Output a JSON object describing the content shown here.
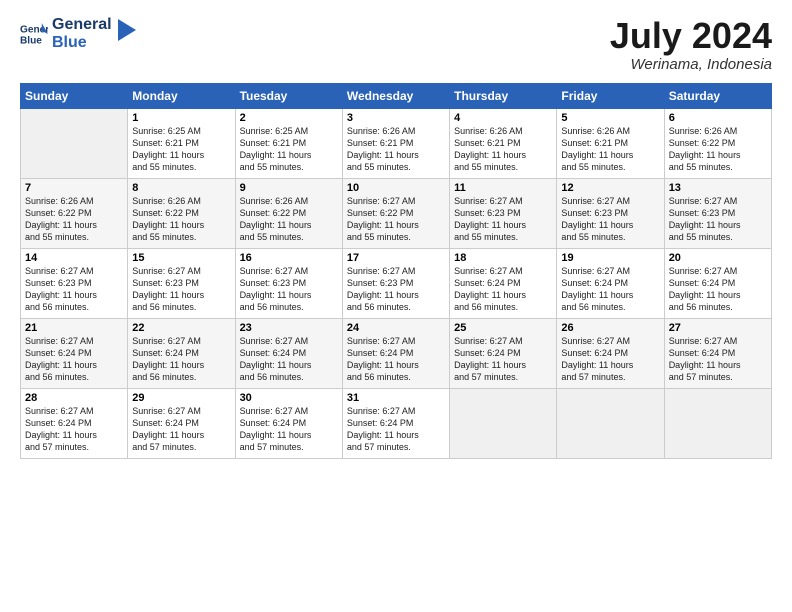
{
  "logo": {
    "line1": "General",
    "line2": "Blue"
  },
  "title": {
    "month_year": "July 2024",
    "location": "Werinama, Indonesia"
  },
  "header_days": [
    "Sunday",
    "Monday",
    "Tuesday",
    "Wednesday",
    "Thursday",
    "Friday",
    "Saturday"
  ],
  "weeks": [
    [
      {
        "num": "",
        "info": ""
      },
      {
        "num": "1",
        "info": "Sunrise: 6:25 AM\nSunset: 6:21 PM\nDaylight: 11 hours\nand 55 minutes."
      },
      {
        "num": "2",
        "info": "Sunrise: 6:25 AM\nSunset: 6:21 PM\nDaylight: 11 hours\nand 55 minutes."
      },
      {
        "num": "3",
        "info": "Sunrise: 6:26 AM\nSunset: 6:21 PM\nDaylight: 11 hours\nand 55 minutes."
      },
      {
        "num": "4",
        "info": "Sunrise: 6:26 AM\nSunset: 6:21 PM\nDaylight: 11 hours\nand 55 minutes."
      },
      {
        "num": "5",
        "info": "Sunrise: 6:26 AM\nSunset: 6:21 PM\nDaylight: 11 hours\nand 55 minutes."
      },
      {
        "num": "6",
        "info": "Sunrise: 6:26 AM\nSunset: 6:22 PM\nDaylight: 11 hours\nand 55 minutes."
      }
    ],
    [
      {
        "num": "7",
        "info": "Sunrise: 6:26 AM\nSunset: 6:22 PM\nDaylight: 11 hours\nand 55 minutes."
      },
      {
        "num": "8",
        "info": "Sunrise: 6:26 AM\nSunset: 6:22 PM\nDaylight: 11 hours\nand 55 minutes."
      },
      {
        "num": "9",
        "info": "Sunrise: 6:26 AM\nSunset: 6:22 PM\nDaylight: 11 hours\nand 55 minutes."
      },
      {
        "num": "10",
        "info": "Sunrise: 6:27 AM\nSunset: 6:22 PM\nDaylight: 11 hours\nand 55 minutes."
      },
      {
        "num": "11",
        "info": "Sunrise: 6:27 AM\nSunset: 6:23 PM\nDaylight: 11 hours\nand 55 minutes."
      },
      {
        "num": "12",
        "info": "Sunrise: 6:27 AM\nSunset: 6:23 PM\nDaylight: 11 hours\nand 55 minutes."
      },
      {
        "num": "13",
        "info": "Sunrise: 6:27 AM\nSunset: 6:23 PM\nDaylight: 11 hours\nand 55 minutes."
      }
    ],
    [
      {
        "num": "14",
        "info": "Sunrise: 6:27 AM\nSunset: 6:23 PM\nDaylight: 11 hours\nand 56 minutes."
      },
      {
        "num": "15",
        "info": "Sunrise: 6:27 AM\nSunset: 6:23 PM\nDaylight: 11 hours\nand 56 minutes."
      },
      {
        "num": "16",
        "info": "Sunrise: 6:27 AM\nSunset: 6:23 PM\nDaylight: 11 hours\nand 56 minutes."
      },
      {
        "num": "17",
        "info": "Sunrise: 6:27 AM\nSunset: 6:23 PM\nDaylight: 11 hours\nand 56 minutes."
      },
      {
        "num": "18",
        "info": "Sunrise: 6:27 AM\nSunset: 6:24 PM\nDaylight: 11 hours\nand 56 minutes."
      },
      {
        "num": "19",
        "info": "Sunrise: 6:27 AM\nSunset: 6:24 PM\nDaylight: 11 hours\nand 56 minutes."
      },
      {
        "num": "20",
        "info": "Sunrise: 6:27 AM\nSunset: 6:24 PM\nDaylight: 11 hours\nand 56 minutes."
      }
    ],
    [
      {
        "num": "21",
        "info": "Sunrise: 6:27 AM\nSunset: 6:24 PM\nDaylight: 11 hours\nand 56 minutes."
      },
      {
        "num": "22",
        "info": "Sunrise: 6:27 AM\nSunset: 6:24 PM\nDaylight: 11 hours\nand 56 minutes."
      },
      {
        "num": "23",
        "info": "Sunrise: 6:27 AM\nSunset: 6:24 PM\nDaylight: 11 hours\nand 56 minutes."
      },
      {
        "num": "24",
        "info": "Sunrise: 6:27 AM\nSunset: 6:24 PM\nDaylight: 11 hours\nand 56 minutes."
      },
      {
        "num": "25",
        "info": "Sunrise: 6:27 AM\nSunset: 6:24 PM\nDaylight: 11 hours\nand 57 minutes."
      },
      {
        "num": "26",
        "info": "Sunrise: 6:27 AM\nSunset: 6:24 PM\nDaylight: 11 hours\nand 57 minutes."
      },
      {
        "num": "27",
        "info": "Sunrise: 6:27 AM\nSunset: 6:24 PM\nDaylight: 11 hours\nand 57 minutes."
      }
    ],
    [
      {
        "num": "28",
        "info": "Sunrise: 6:27 AM\nSunset: 6:24 PM\nDaylight: 11 hours\nand 57 minutes."
      },
      {
        "num": "29",
        "info": "Sunrise: 6:27 AM\nSunset: 6:24 PM\nDaylight: 11 hours\nand 57 minutes."
      },
      {
        "num": "30",
        "info": "Sunrise: 6:27 AM\nSunset: 6:24 PM\nDaylight: 11 hours\nand 57 minutes."
      },
      {
        "num": "31",
        "info": "Sunrise: 6:27 AM\nSunset: 6:24 PM\nDaylight: 11 hours\nand 57 minutes."
      },
      {
        "num": "",
        "info": ""
      },
      {
        "num": "",
        "info": ""
      },
      {
        "num": "",
        "info": ""
      }
    ]
  ]
}
